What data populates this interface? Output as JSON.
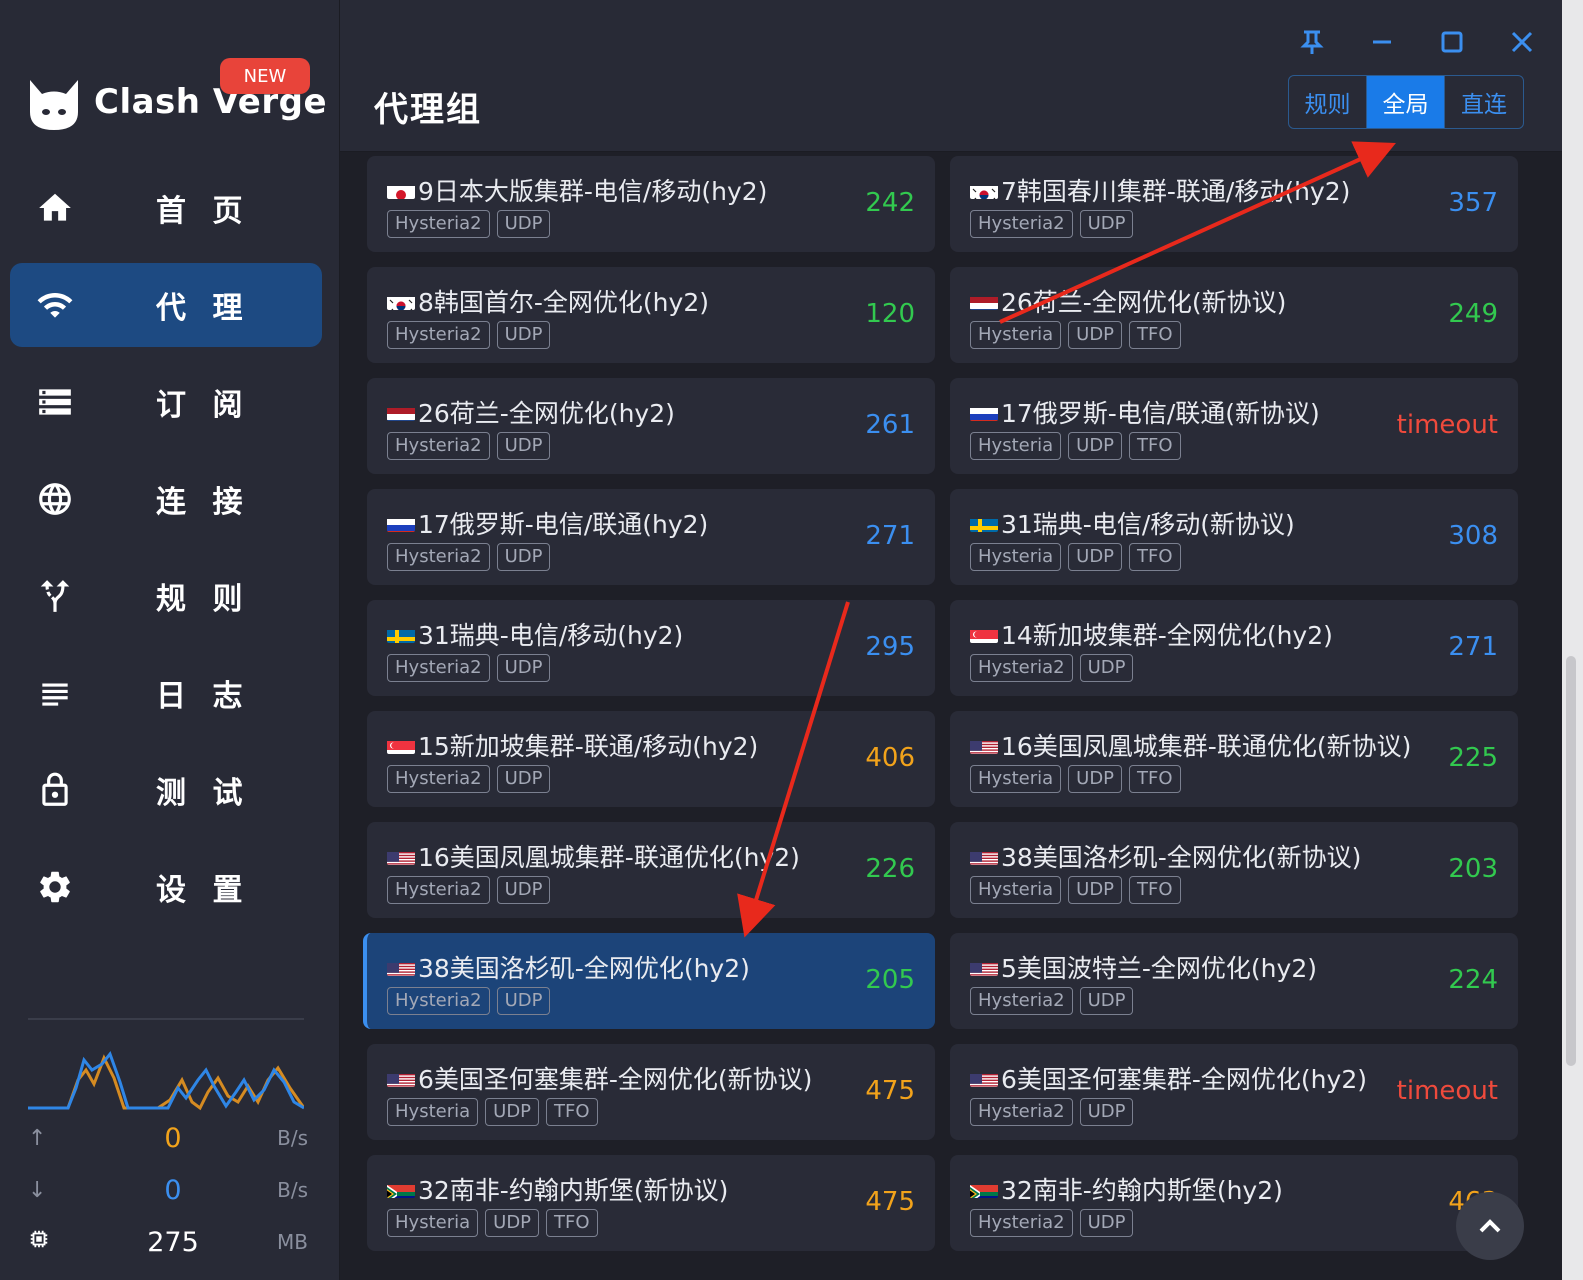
{
  "app": {
    "name": "Clash Verge",
    "new_badge": "NEW"
  },
  "sidebar": {
    "items": [
      {
        "label": "首 页",
        "icon": "home-icon",
        "active": false
      },
      {
        "label": "代 理",
        "icon": "wifi-icon",
        "active": true
      },
      {
        "label": "订 阅",
        "icon": "storage-icon",
        "active": false
      },
      {
        "label": "连 接",
        "icon": "globe-icon",
        "active": false
      },
      {
        "label": "规 则",
        "icon": "fork-arrow-icon",
        "active": false
      },
      {
        "label": "日 志",
        "icon": "list-lines-icon",
        "active": false
      },
      {
        "label": "测 试",
        "icon": "lock-icon",
        "active": false
      },
      {
        "label": "设 置",
        "icon": "gear-icon",
        "active": false
      }
    ],
    "traffic": {
      "upload_value": "0",
      "upload_unit": "B/s",
      "download_value": "0",
      "download_unit": "B/s",
      "memory_value": "275",
      "memory_unit": "MB"
    }
  },
  "header": {
    "title": "代理组",
    "modes": [
      {
        "label": "规则",
        "active": false
      },
      {
        "label": "全局",
        "active": true
      },
      {
        "label": "直连",
        "active": false
      }
    ]
  },
  "proxies": [
    {
      "flag": "jp",
      "name": "9日本大版集群-电信/移动(hy2)",
      "tags": [
        "Hysteria2",
        "UDP"
      ],
      "latency": "242",
      "color": "green",
      "selected": false
    },
    {
      "flag": "kr",
      "name": "7韩国春川集群-联通/移动(hy2)",
      "tags": [
        "Hysteria2",
        "UDP"
      ],
      "latency": "357",
      "color": "blue",
      "selected": false
    },
    {
      "flag": "kr",
      "name": "8韩国首尔-全网优化(hy2)",
      "tags": [
        "Hysteria2",
        "UDP"
      ],
      "latency": "120",
      "color": "green",
      "selected": false
    },
    {
      "flag": "nl",
      "name": "26荷兰-全网优化(新协议)",
      "tags": [
        "Hysteria",
        "UDP",
        "TFO"
      ],
      "latency": "249",
      "color": "green",
      "selected": false
    },
    {
      "flag": "nl",
      "name": "26荷兰-全网优化(hy2)",
      "tags": [
        "Hysteria2",
        "UDP"
      ],
      "latency": "261",
      "color": "blue",
      "selected": false
    },
    {
      "flag": "ru",
      "name": "17俄罗斯-电信/联通(新协议)",
      "tags": [
        "Hysteria",
        "UDP",
        "TFO"
      ],
      "latency": "timeout",
      "color": "red",
      "selected": false
    },
    {
      "flag": "ru",
      "name": "17俄罗斯-电信/联通(hy2)",
      "tags": [
        "Hysteria2",
        "UDP"
      ],
      "latency": "271",
      "color": "blue",
      "selected": false
    },
    {
      "flag": "se",
      "name": "31瑞典-电信/移动(新协议)",
      "tags": [
        "Hysteria",
        "UDP",
        "TFO"
      ],
      "latency": "308",
      "color": "blue",
      "selected": false
    },
    {
      "flag": "se",
      "name": "31瑞典-电信/移动(hy2)",
      "tags": [
        "Hysteria2",
        "UDP"
      ],
      "latency": "295",
      "color": "blue",
      "selected": false
    },
    {
      "flag": "sg",
      "name": "14新加坡集群-全网优化(hy2)",
      "tags": [
        "Hysteria2",
        "UDP"
      ],
      "latency": "271",
      "color": "blue",
      "selected": false
    },
    {
      "flag": "sg",
      "name": "15新加坡集群-联通/移动(hy2)",
      "tags": [
        "Hysteria2",
        "UDP"
      ],
      "latency": "406",
      "color": "orange",
      "selected": false
    },
    {
      "flag": "us",
      "name": "16美国凤凰城集群-联通优化(新协议)",
      "tags": [
        "Hysteria",
        "UDP",
        "TFO"
      ],
      "latency": "225",
      "color": "green",
      "selected": false
    },
    {
      "flag": "us",
      "name": "16美国凤凰城集群-联通优化(hy2)",
      "tags": [
        "Hysteria2",
        "UDP"
      ],
      "latency": "226",
      "color": "green",
      "selected": false
    },
    {
      "flag": "us",
      "name": "38美国洛杉矶-全网优化(新协议)",
      "tags": [
        "Hysteria",
        "UDP",
        "TFO"
      ],
      "latency": "203",
      "color": "green",
      "selected": false
    },
    {
      "flag": "us",
      "name": "38美国洛杉矶-全网优化(hy2)",
      "tags": [
        "Hysteria2",
        "UDP"
      ],
      "latency": "205",
      "color": "green",
      "selected": true
    },
    {
      "flag": "us",
      "name": "5美国波特兰-全网优化(hy2)",
      "tags": [
        "Hysteria2",
        "UDP"
      ],
      "latency": "224",
      "color": "green",
      "selected": false
    },
    {
      "flag": "us",
      "name": "6美国圣何塞集群-全网优化(新协议)",
      "tags": [
        "Hysteria",
        "UDP",
        "TFO"
      ],
      "latency": "475",
      "color": "orange",
      "selected": false
    },
    {
      "flag": "us",
      "name": "6美国圣何塞集群-全网优化(hy2)",
      "tags": [
        "Hysteria2",
        "UDP"
      ],
      "latency": "timeout",
      "color": "red",
      "selected": false
    },
    {
      "flag": "za",
      "name": "32南非-约翰内斯堡(新协议)",
      "tags": [
        "Hysteria",
        "UDP",
        "TFO"
      ],
      "latency": "475",
      "color": "orange",
      "selected": false
    },
    {
      "flag": "za",
      "name": "32南非-约翰内斯堡(hy2)",
      "tags": [
        "Hysteria2",
        "UDP"
      ],
      "latency": "463",
      "color": "orange",
      "selected": false
    }
  ],
  "colors": {
    "accent": "#3b8ff0",
    "selected_bg": "#1c4479",
    "green": "#32c94f",
    "blue": "#3b8ff0",
    "orange": "#f2a31b",
    "red": "#ef4a3c",
    "annotation_arrow": "#e8291c"
  }
}
